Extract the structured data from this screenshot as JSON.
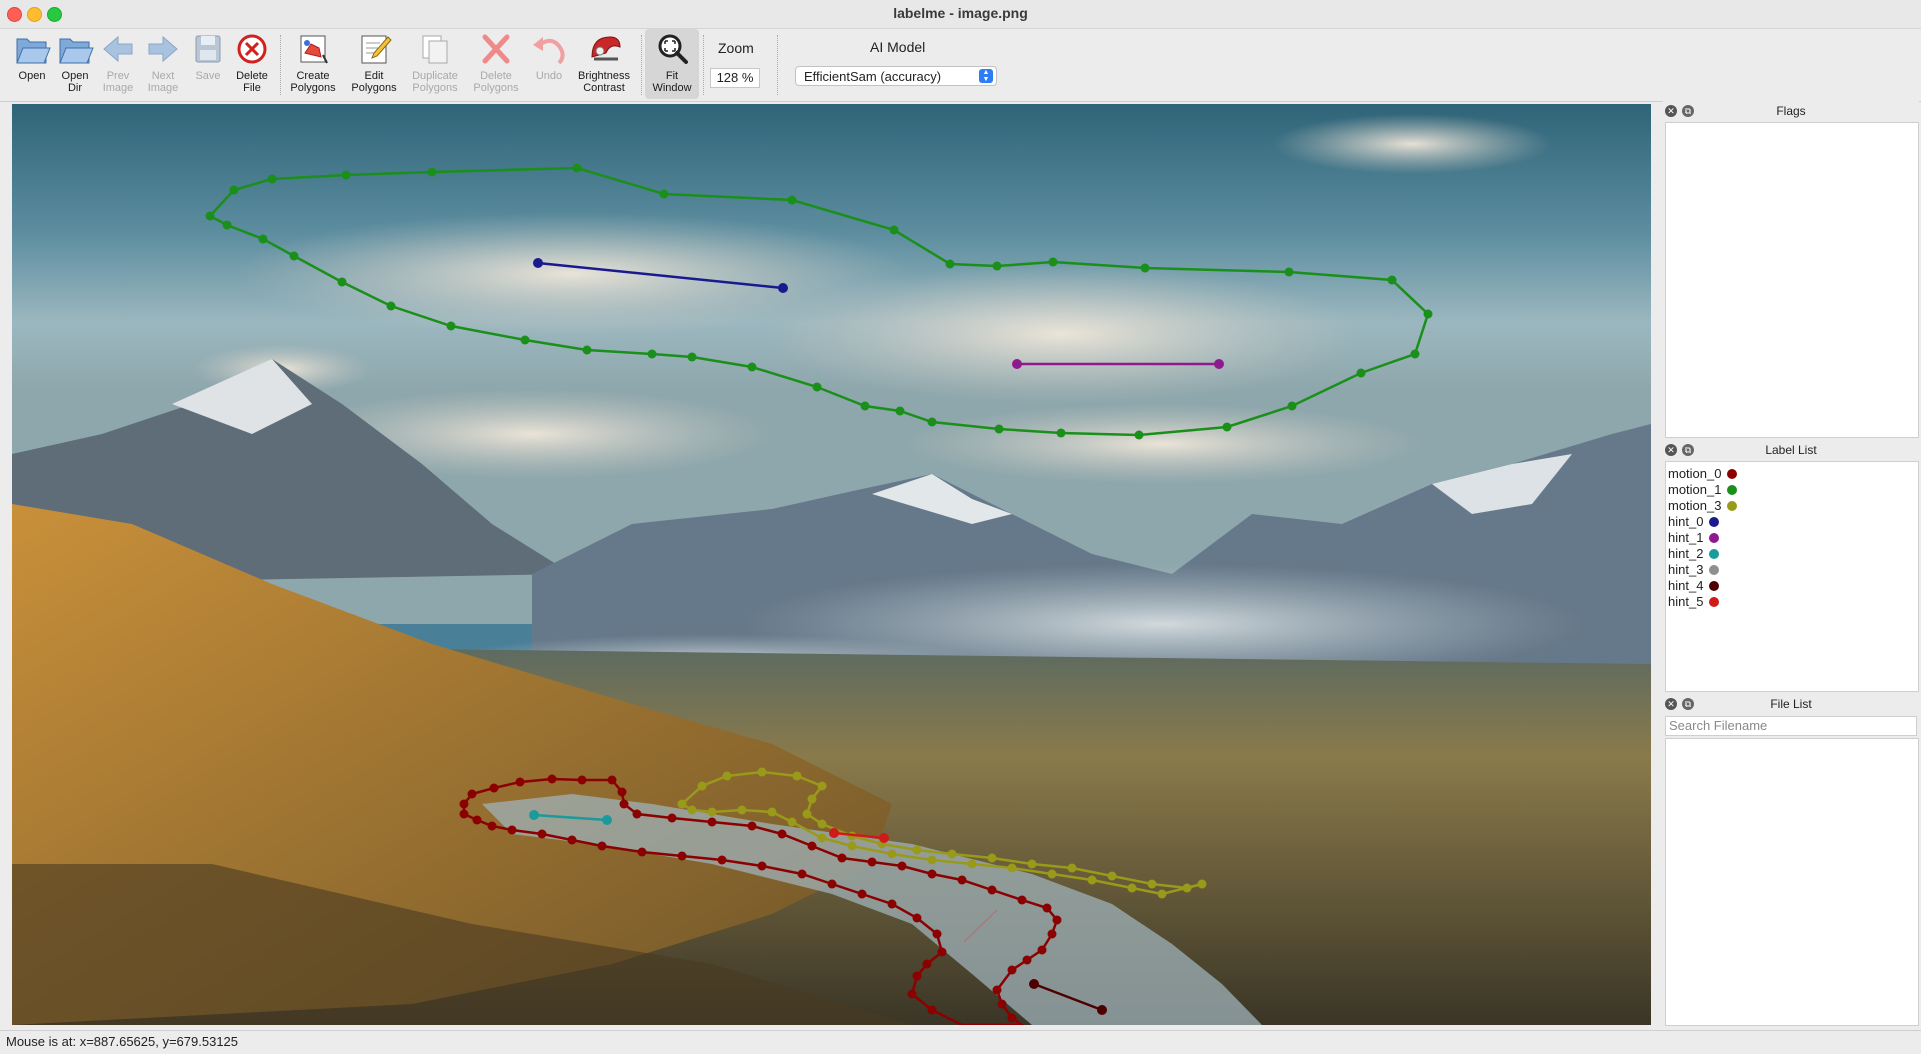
{
  "window": {
    "title": "labelme - image.png"
  },
  "toolbar": {
    "open": "Open",
    "open_dir": "Open\nDir",
    "prev_image": "Prev\nImage",
    "next_image": "Next\nImage",
    "save": "Save",
    "delete_file": "Delete\nFile",
    "create_polygons": "Create\nPolygons",
    "edit_polygons": "Edit\nPolygons",
    "duplicate_polygons": "Duplicate\nPolygons",
    "delete_polygons": "Delete\nPolygons",
    "undo": "Undo",
    "brightness_contrast": "Brightness\nContrast",
    "fit_window": "Fit\nWindow",
    "zoom_label": "Zoom",
    "zoom_value": "128 %",
    "ai_model_label": "AI Model",
    "ai_model_value": "EfficientSam (accuracy)"
  },
  "docks": {
    "flags": {
      "title": "Flags"
    },
    "label_list": {
      "title": "Label List",
      "items": [
        {
          "label": "motion_0",
          "color": "#8b0000"
        },
        {
          "label": "motion_1",
          "color": "#1a8f1a"
        },
        {
          "label": "motion_3",
          "color": "#9a9a1a"
        },
        {
          "label": "hint_0",
          "color": "#1a1a8f"
        },
        {
          "label": "hint_1",
          "color": "#8f1a8f"
        },
        {
          "label": "hint_2",
          "color": "#1a9a9a"
        },
        {
          "label": "hint_3",
          "color": "#8f8f8f"
        },
        {
          "label": "hint_4",
          "color": "#4d0000"
        },
        {
          "label": "hint_5",
          "color": "#d01a1a"
        }
      ]
    },
    "file_list": {
      "title": "File List",
      "search_placeholder": "Search Filename"
    }
  },
  "status": {
    "text": "Mouse is at: x=887.65625, y=679.53125"
  },
  "icons": {
    "open": "folder-open-icon",
    "open_dir": "folder-icon",
    "prev": "arrow-left-icon",
    "next": "arrow-right-icon",
    "save": "floppy-icon",
    "delete_file": "delete-circle-icon",
    "create": "create-polygon-icon",
    "edit": "edit-pencil-icon",
    "duplicate": "duplicate-icon",
    "delete_poly": "delete-x-icon",
    "undo": "undo-icon",
    "brightness": "brightness-icon",
    "fit": "fit-window-icon"
  }
}
